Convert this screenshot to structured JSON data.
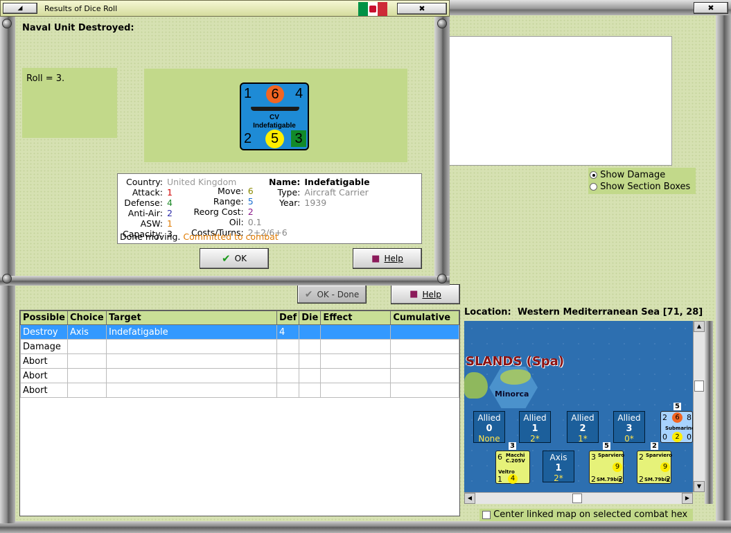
{
  "dialog": {
    "title": "Results of Dice Roll",
    "heading": "Naval Unit Destroyed:",
    "roll_text": "Roll = 3.",
    "ok_label": "OK",
    "help_label": "Help"
  },
  "unit_counter": {
    "top_left": "1",
    "attack": "6",
    "top_right": "4",
    "type": "CV",
    "name": "Indefatigable",
    "bottom_left": "2",
    "range": "5",
    "bottom_right": "3",
    "colors": {
      "background": "#1e8bd6",
      "attack": "#f26522",
      "range": "#ffee00",
      "bottom_right": "#128a2a"
    }
  },
  "unit_info": {
    "country_label": "Country:",
    "country": "United Kingdom",
    "attack_label": "Attack:",
    "attack": "1",
    "defense_label": "Defense:",
    "defense": "4",
    "antiair_label": "Anti-Air:",
    "antiair": "2",
    "asw_label": "ASW:",
    "asw": "1",
    "capacity_label": "Capacity:",
    "capacity": "3",
    "move_label": "Move:",
    "move": "6",
    "range_label": "Range:",
    "range": "5",
    "reorg_label": "Reorg Cost:",
    "reorg": "2",
    "oil_label": "Oil:",
    "oil": "0.1",
    "costs_label": "Costs/Turns:",
    "costs": "2+2/6+6",
    "name_label": "Name:",
    "name": "Indefatigable",
    "type_label": "Type:",
    "type": "Aircraft Carrier",
    "year_label": "Year:",
    "year": "1939",
    "status_moving": "Done moving.",
    "status_combat": "Committed to combat"
  },
  "main_buttons": {
    "ok_done": "OK - Done",
    "help": "Help"
  },
  "table": {
    "headers": [
      "Possible",
      "Choice",
      "Target",
      "Def",
      "Die",
      "Effect",
      "Cumulative"
    ],
    "rows": [
      [
        "Destroy",
        "Axis",
        "Indefatigable",
        "4",
        "",
        "",
        ""
      ],
      [
        "Damage",
        "",
        "",
        "",
        "",
        "",
        ""
      ],
      [
        "Abort",
        "",
        "",
        "",
        "",
        "",
        ""
      ],
      [
        "Abort",
        "",
        "",
        "",
        "",
        "",
        ""
      ],
      [
        "Abort",
        "",
        "",
        "",
        "",
        "",
        ""
      ]
    ]
  },
  "display_options": {
    "show_damage": "Show Damage",
    "show_section_boxes": "Show Section Boxes"
  },
  "location": {
    "label": "Location:",
    "value": "Western Mediterranean Sea [71, 28]"
  },
  "map": {
    "region_label": "SLANDS (Spa)",
    "island": "Minorca",
    "stacks": [
      {
        "side": "Allied",
        "num": "0",
        "sub": "None"
      },
      {
        "side": "Allied",
        "num": "1",
        "sub": "2*"
      },
      {
        "side": "Allied",
        "num": "2",
        "sub": "1*"
      },
      {
        "side": "Allied",
        "num": "3",
        "sub": "0*"
      },
      {
        "side": "Axis",
        "num": "1",
        "sub": "2*"
      }
    ],
    "submarine": {
      "stack": "5",
      "l": "2",
      "a": "6",
      "r": "8",
      "name": "Submarine",
      "bl": "0",
      "m": "2",
      "br": "0"
    },
    "macchi": {
      "stack": "3",
      "tl": "6",
      "name1": "Macchi",
      "name2": "C.205V",
      "name3": "Veltro",
      "bl": "1",
      "br": "4"
    },
    "sparviero1": {
      "stack": "5",
      "tl": "3",
      "name": "Sparviero",
      "tr": "9",
      "bl": "2",
      "sm": "SM.79bis",
      "br": "2"
    },
    "sparviero2": {
      "stack": "2",
      "tl": "2",
      "name": "Sparviero",
      "tr": "9",
      "bl": "2",
      "sm": "SM.79bis",
      "br": "2"
    }
  },
  "center_link_label": "Center linked map on selected combat hex"
}
